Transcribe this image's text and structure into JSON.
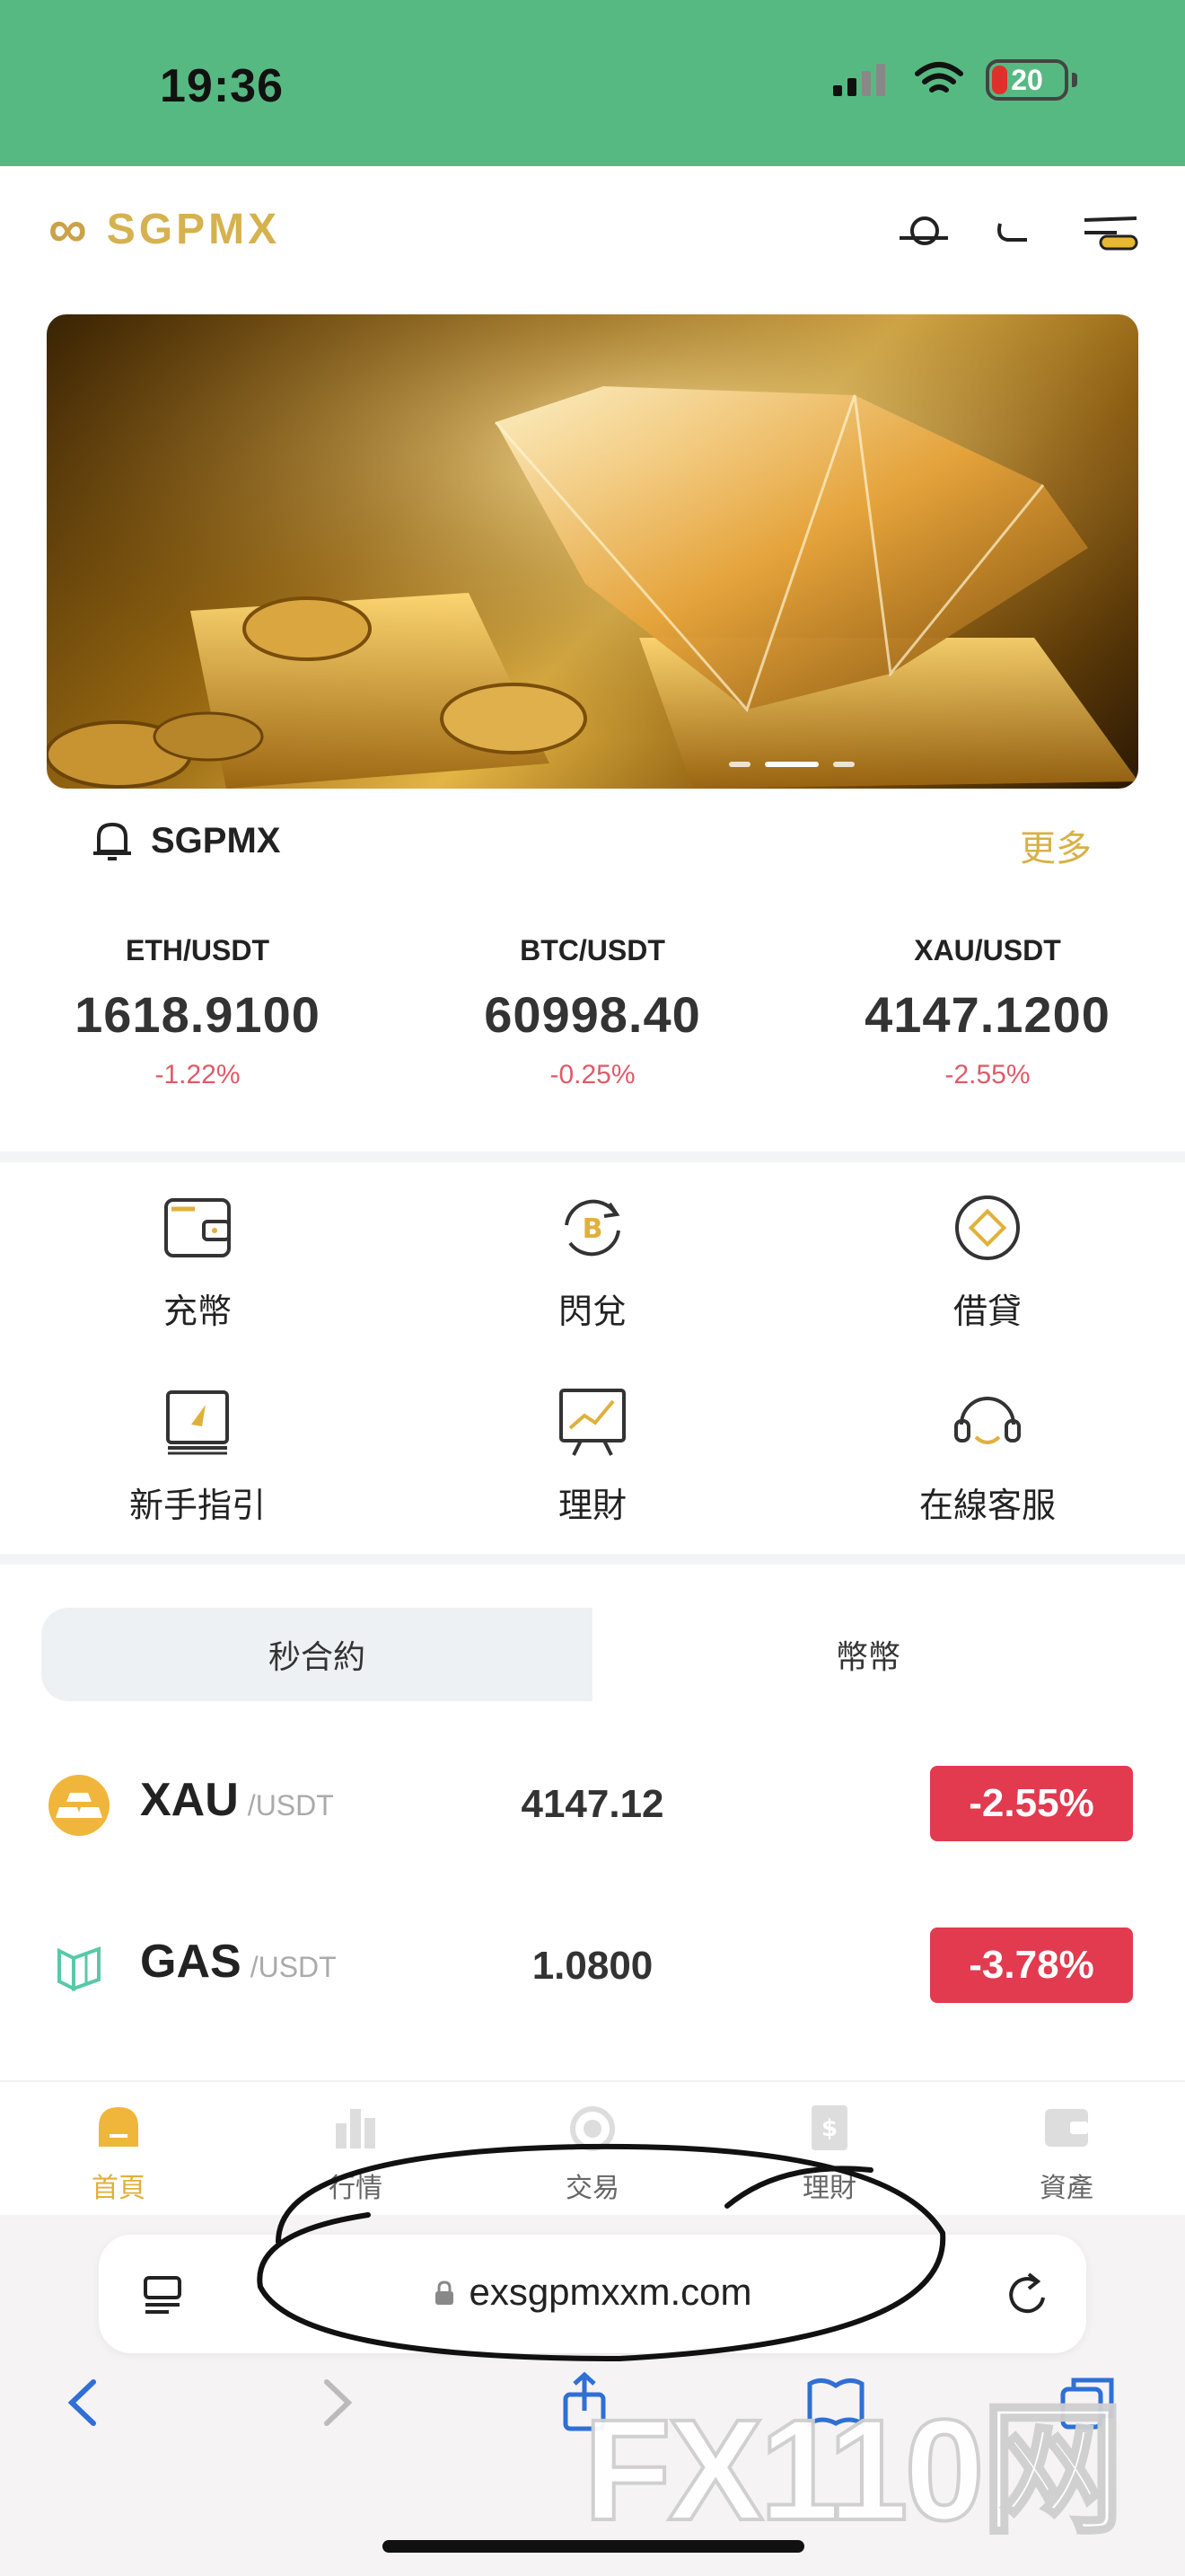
{
  "status_bar": {
    "time": "19:36",
    "battery": "20"
  },
  "brand": {
    "name": "SGPMX",
    "accent": "#d5b24f"
  },
  "notice": {
    "text": "SGPMX",
    "more": "更多"
  },
  "tickers": [
    {
      "pair": "ETH/USDT",
      "price": "1618.9100",
      "change": "-1.22%"
    },
    {
      "pair": "BTC/USDT",
      "price": "60998.40",
      "change": "-0.25%"
    },
    {
      "pair": "XAU/USDT",
      "price": "4147.1200",
      "change": "-2.55%"
    }
  ],
  "menu": [
    {
      "label": "充幣",
      "icon": "wallet-icon"
    },
    {
      "label": "閃兌",
      "icon": "exchange-icon"
    },
    {
      "label": "借貸",
      "icon": "loan-icon"
    },
    {
      "label": "新手指引",
      "icon": "guide-icon"
    },
    {
      "label": "理財",
      "icon": "finance-icon"
    },
    {
      "label": "在線客服",
      "icon": "support-icon"
    }
  ],
  "tabs": [
    {
      "label": "秒合約",
      "active": true
    },
    {
      "label": "幣幣",
      "active": false
    }
  ],
  "market": [
    {
      "symbol": "XAU",
      "quote": "/USDT",
      "price": "4147.12",
      "change": "-2.55%"
    },
    {
      "symbol": "GAS",
      "quote": "/USDT",
      "price": "1.0800",
      "change": "-3.78%"
    }
  ],
  "bottom_nav": [
    {
      "label": "首頁",
      "active": true
    },
    {
      "label": "行情",
      "active": false
    },
    {
      "label": "交易",
      "active": false
    },
    {
      "label": "理財",
      "active": false
    },
    {
      "label": "資產",
      "active": false
    }
  ],
  "browser": {
    "url": "exsgpmxxm.com"
  },
  "watermark": "FX110网",
  "colors": {
    "status_bar": "#57b982",
    "negative": "#e23a4f",
    "gold": "#e0b03a"
  }
}
